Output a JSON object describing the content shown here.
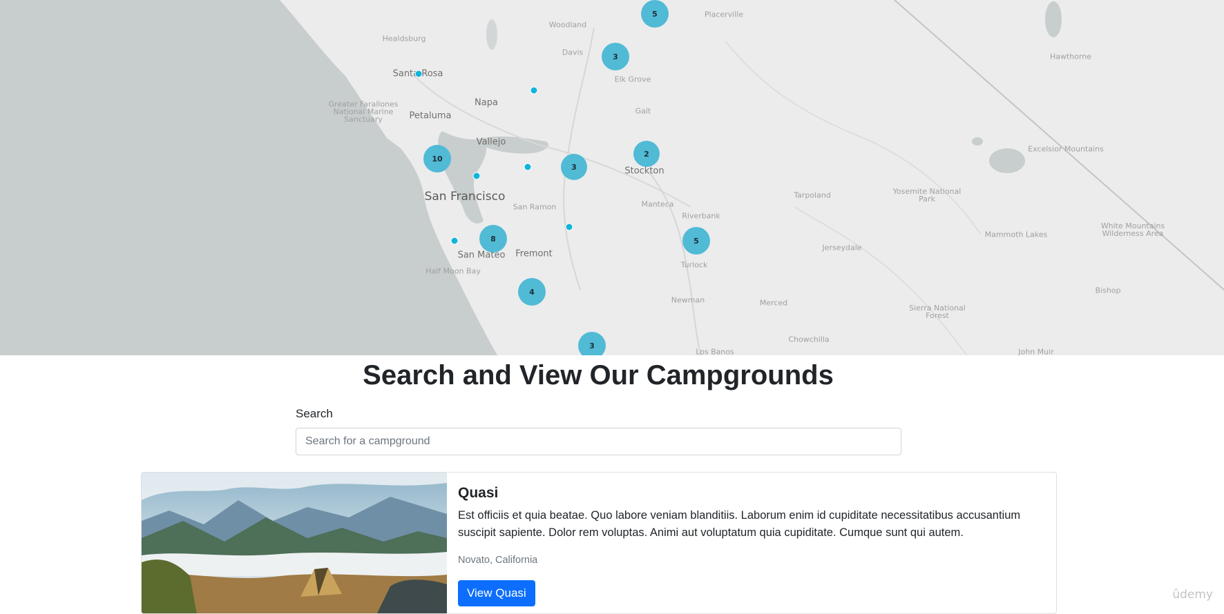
{
  "map": {
    "places": [
      {
        "name": "Placerville",
        "kind": "small"
      },
      {
        "name": "Healdsburg",
        "kind": "small"
      },
      {
        "name": "Woodland",
        "kind": "small"
      },
      {
        "name": "Davis",
        "kind": "small"
      },
      {
        "name": "Santa Rosa",
        "kind": "city"
      },
      {
        "name": "Elk Grove",
        "kind": "small"
      },
      {
        "name": "Napa",
        "kind": "city"
      },
      {
        "name": "Petaluma",
        "kind": "city"
      },
      {
        "name": "Galt",
        "kind": "small"
      },
      {
        "name": "Vallejo",
        "kind": "city"
      },
      {
        "name": "Stockton",
        "kind": "city"
      },
      {
        "name": "San Francisco",
        "kind": "big"
      },
      {
        "name": "San Ramon",
        "kind": "small"
      },
      {
        "name": "Manteca",
        "kind": "small"
      },
      {
        "name": "Riverbank",
        "kind": "small"
      },
      {
        "name": "Fremont",
        "kind": "city"
      },
      {
        "name": "San Mateo",
        "kind": "city"
      },
      {
        "name": "Half Moon Bay",
        "kind": "small"
      },
      {
        "name": "Turlock",
        "kind": "small"
      },
      {
        "name": "Newman",
        "kind": "small"
      },
      {
        "name": "Merced",
        "kind": "small"
      },
      {
        "name": "Chowchilla",
        "kind": "small"
      },
      {
        "name": "Los Banos",
        "kind": "small"
      },
      {
        "name": "Jerseydale",
        "kind": "small"
      },
      {
        "name": "Tarpoland",
        "kind": "small"
      },
      {
        "name": "Yosemite National Park",
        "kind": "small"
      },
      {
        "name": "Mammoth Lakes",
        "kind": "small"
      },
      {
        "name": "Bishop",
        "kind": "small"
      },
      {
        "name": "Sierra National Forest",
        "kind": "small"
      },
      {
        "name": "Hawthorne",
        "kind": "small"
      },
      {
        "name": "Excelsior Mountains",
        "kind": "small"
      },
      {
        "name": "White Mountains Wilderness Area",
        "kind": "small"
      },
      {
        "name": "John Muir",
        "kind": "small"
      },
      {
        "name": "Greater Farallones National Marine Sanctuary",
        "kind": "small"
      }
    ],
    "clusters": [
      {
        "count": "5"
      },
      {
        "count": "3"
      },
      {
        "count": "10"
      },
      {
        "count": "3"
      },
      {
        "count": "2"
      },
      {
        "count": "8"
      },
      {
        "count": "5"
      },
      {
        "count": "4"
      },
      {
        "count": "3"
      }
    ],
    "colors": {
      "cluster": "#51bbd6",
      "point": "#11b4da",
      "water": "#c8cdcd",
      "land": "#ececec"
    }
  },
  "header": {
    "title": "Search and View Our Campgrounds"
  },
  "search": {
    "label": "Search",
    "placeholder": "Search for a campground",
    "value": ""
  },
  "campgrounds": [
    {
      "title": "Quasi",
      "description": "Est officiis et quia beatae. Quo labore veniam blanditiis. Laborum enim id cupiditate necessitatibus accusantium suscipit sapiente. Dolor rem voluptas. Animi aut voluptatum quia cupiditate. Cumque sunt qui autem.",
      "location": "Novato, California",
      "button_label": "View Quasi"
    }
  ],
  "watermark": "ûdemy",
  "primary_color": "#0d6efd"
}
